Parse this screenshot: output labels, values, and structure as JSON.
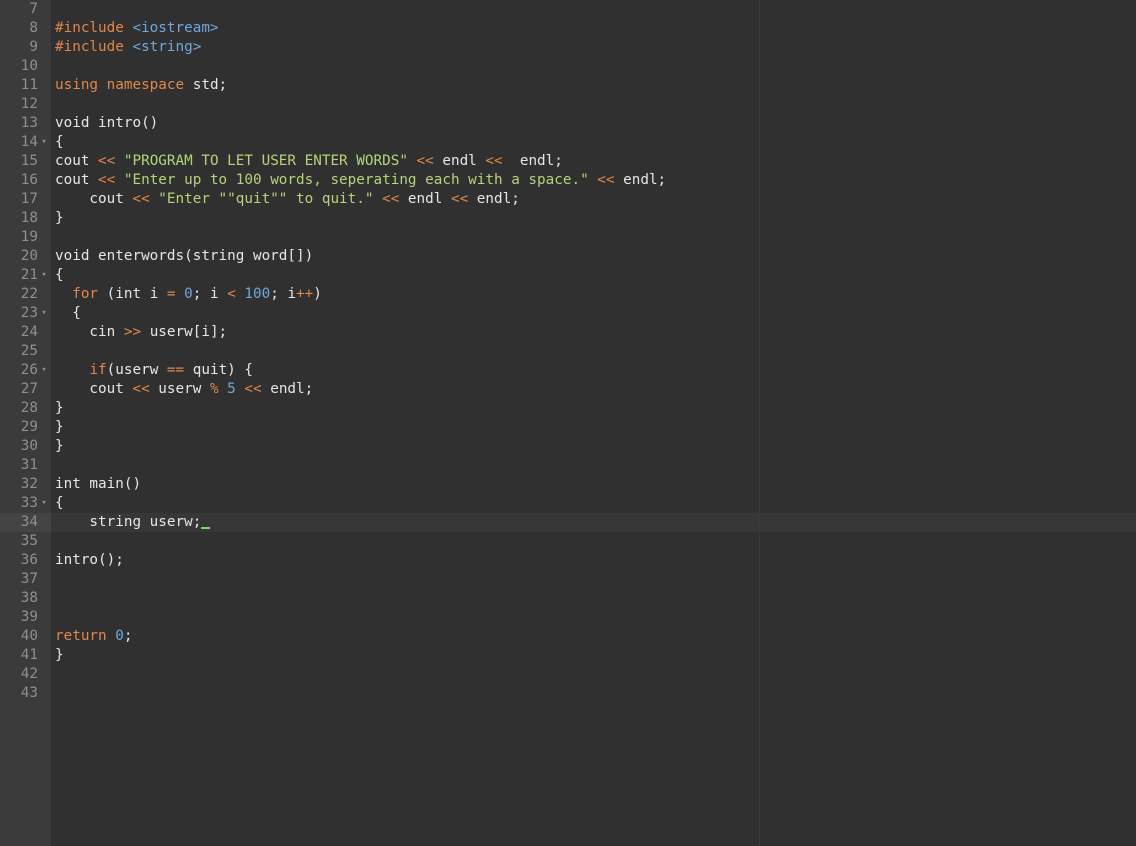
{
  "editor": {
    "active_line": 34,
    "lines": [
      {
        "n": "7",
        "fold": false,
        "tokens": []
      },
      {
        "n": "8",
        "fold": false,
        "tokens": [
          {
            "t": "#include ",
            "c": "kw"
          },
          {
            "t": "<iostream>",
            "c": "num"
          }
        ]
      },
      {
        "n": "9",
        "fold": false,
        "tokens": [
          {
            "t": "#include ",
            "c": "kw"
          },
          {
            "t": "<string>",
            "c": "num"
          }
        ]
      },
      {
        "n": "10",
        "fold": false,
        "tokens": []
      },
      {
        "n": "11",
        "fold": false,
        "tokens": [
          {
            "t": "using namespace",
            "c": "kw"
          },
          {
            "t": " std;",
            "c": "pl"
          }
        ]
      },
      {
        "n": "12",
        "fold": false,
        "tokens": []
      },
      {
        "n": "13",
        "fold": false,
        "tokens": [
          {
            "t": "void intro()",
            "c": "pl"
          }
        ]
      },
      {
        "n": "14",
        "fold": true,
        "tokens": [
          {
            "t": "{",
            "c": "pl"
          }
        ]
      },
      {
        "n": "15",
        "fold": false,
        "tokens": [
          {
            "t": "cout ",
            "c": "pl"
          },
          {
            "t": "<<",
            "c": "op"
          },
          {
            "t": " ",
            "c": "pl"
          },
          {
            "t": "\"PROGRAM TO LET USER ENTER WORDS\"",
            "c": "str"
          },
          {
            "t": " ",
            "c": "pl"
          },
          {
            "t": "<<",
            "c": "op"
          },
          {
            "t": " endl ",
            "c": "pl"
          },
          {
            "t": "<<",
            "c": "op"
          },
          {
            "t": "  endl;",
            "c": "pl"
          }
        ]
      },
      {
        "n": "16",
        "fold": false,
        "tokens": [
          {
            "t": "cout ",
            "c": "pl"
          },
          {
            "t": "<<",
            "c": "op"
          },
          {
            "t": " ",
            "c": "pl"
          },
          {
            "t": "\"Enter up to 100 words, seperating each with a space.\"",
            "c": "str"
          },
          {
            "t": " ",
            "c": "pl"
          },
          {
            "t": "<<",
            "c": "op"
          },
          {
            "t": " endl;",
            "c": "pl"
          }
        ]
      },
      {
        "n": "17",
        "fold": false,
        "tokens": [
          {
            "t": "    cout ",
            "c": "pl"
          },
          {
            "t": "<<",
            "c": "op"
          },
          {
            "t": " ",
            "c": "pl"
          },
          {
            "t": "\"Enter \"\"quit\"\" to quit.\"",
            "c": "str"
          },
          {
            "t": " ",
            "c": "pl"
          },
          {
            "t": "<<",
            "c": "op"
          },
          {
            "t": " endl ",
            "c": "pl"
          },
          {
            "t": "<<",
            "c": "op"
          },
          {
            "t": " endl;",
            "c": "pl"
          }
        ]
      },
      {
        "n": "18",
        "fold": false,
        "tokens": [
          {
            "t": "}",
            "c": "pl"
          }
        ]
      },
      {
        "n": "19",
        "fold": false,
        "tokens": []
      },
      {
        "n": "20",
        "fold": false,
        "tokens": [
          {
            "t": "void enterwords(string word[])",
            "c": "pl"
          }
        ]
      },
      {
        "n": "21",
        "fold": true,
        "tokens": [
          {
            "t": "{",
            "c": "pl"
          }
        ]
      },
      {
        "n": "22",
        "fold": false,
        "tokens": [
          {
            "t": "  ",
            "c": "pl"
          },
          {
            "t": "for",
            "c": "kw"
          },
          {
            "t": " (int i ",
            "c": "pl"
          },
          {
            "t": "=",
            "c": "op"
          },
          {
            "t": " ",
            "c": "pl"
          },
          {
            "t": "0",
            "c": "num"
          },
          {
            "t": "; i ",
            "c": "pl"
          },
          {
            "t": "<",
            "c": "op"
          },
          {
            "t": " ",
            "c": "pl"
          },
          {
            "t": "100",
            "c": "num"
          },
          {
            "t": "; i",
            "c": "pl"
          },
          {
            "t": "++",
            "c": "op"
          },
          {
            "t": ")",
            "c": "pl"
          }
        ]
      },
      {
        "n": "23",
        "fold": true,
        "tokens": [
          {
            "t": "  {",
            "c": "pl"
          }
        ]
      },
      {
        "n": "24",
        "fold": false,
        "tokens": [
          {
            "t": "    cin ",
            "c": "pl"
          },
          {
            "t": ">>",
            "c": "op"
          },
          {
            "t": " userw[i];",
            "c": "pl"
          }
        ]
      },
      {
        "n": "25",
        "fold": false,
        "tokens": []
      },
      {
        "n": "26",
        "fold": true,
        "tokens": [
          {
            "t": "    ",
            "c": "pl"
          },
          {
            "t": "if",
            "c": "kw"
          },
          {
            "t": "(userw ",
            "c": "pl"
          },
          {
            "t": "==",
            "c": "op"
          },
          {
            "t": " quit) {",
            "c": "pl"
          }
        ]
      },
      {
        "n": "27",
        "fold": false,
        "tokens": [
          {
            "t": "    cout ",
            "c": "pl"
          },
          {
            "t": "<<",
            "c": "op"
          },
          {
            "t": " userw ",
            "c": "pl"
          },
          {
            "t": "%",
            "c": "op"
          },
          {
            "t": " ",
            "c": "pl"
          },
          {
            "t": "5",
            "c": "num"
          },
          {
            "t": " ",
            "c": "pl"
          },
          {
            "t": "<<",
            "c": "op"
          },
          {
            "t": " endl;",
            "c": "pl"
          }
        ]
      },
      {
        "n": "28",
        "fold": false,
        "tokens": [
          {
            "t": "}",
            "c": "pl"
          }
        ]
      },
      {
        "n": "29",
        "fold": false,
        "tokens": [
          {
            "t": "}",
            "c": "pl"
          }
        ]
      },
      {
        "n": "30",
        "fold": false,
        "tokens": [
          {
            "t": "}",
            "c": "pl"
          }
        ]
      },
      {
        "n": "31",
        "fold": false,
        "tokens": []
      },
      {
        "n": "32",
        "fold": false,
        "tokens": [
          {
            "t": "int main()",
            "c": "pl"
          }
        ]
      },
      {
        "n": "33",
        "fold": true,
        "tokens": [
          {
            "t": "{",
            "c": "pl"
          }
        ]
      },
      {
        "n": "34",
        "fold": false,
        "cursor": true,
        "tokens": [
          {
            "t": "    string userw;",
            "c": "pl"
          }
        ]
      },
      {
        "n": "35",
        "fold": false,
        "tokens": []
      },
      {
        "n": "36",
        "fold": false,
        "tokens": [
          {
            "t": "intro();",
            "c": "pl"
          }
        ]
      },
      {
        "n": "37",
        "fold": false,
        "tokens": []
      },
      {
        "n": "38",
        "fold": false,
        "tokens": []
      },
      {
        "n": "39",
        "fold": false,
        "tokens": []
      },
      {
        "n": "40",
        "fold": false,
        "tokens": [
          {
            "t": "return",
            "c": "kw"
          },
          {
            "t": " ",
            "c": "pl"
          },
          {
            "t": "0",
            "c": "num"
          },
          {
            "t": ";",
            "c": "pl"
          }
        ]
      },
      {
        "n": "41",
        "fold": false,
        "tokens": [
          {
            "t": "}",
            "c": "pl"
          }
        ]
      },
      {
        "n": "42",
        "fold": false,
        "tokens": []
      },
      {
        "n": "43",
        "fold": false,
        "tokens": []
      }
    ]
  },
  "colors": {
    "background": "#303030",
    "gutter": "#3b3b3b",
    "keyword": "#e1874a",
    "string": "#b6d37a",
    "number": "#70a7d9",
    "plain": "#e6e6e6",
    "cursor": "#7cd36f"
  },
  "icons": {
    "fold": "fold-arrow-icon"
  }
}
